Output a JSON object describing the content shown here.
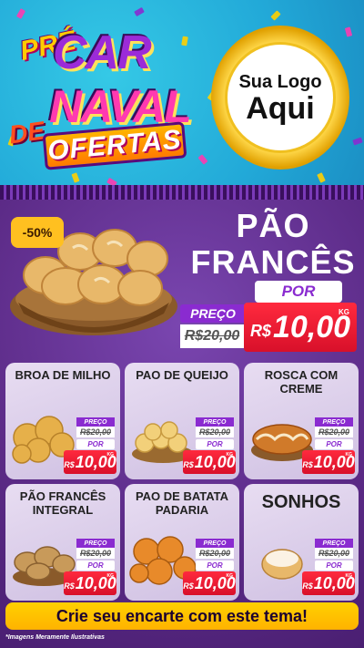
{
  "header": {
    "pre": "PRÉ",
    "car": "CAR",
    "naval": "NAVAL",
    "de": "DE",
    "ofertas": "OFERTAS",
    "logo_line1": "Sua Logo",
    "logo_line2": "Aqui"
  },
  "hero": {
    "discount_badge": "-50%",
    "title_line1": "PÃO",
    "title_line2": "FRANCÊS",
    "preco_label": "PREÇO",
    "old_price": "R$20,00",
    "por_label": "POR",
    "currency": "R$",
    "price": "10,00",
    "unit": "KG"
  },
  "cards": [
    {
      "name": "BROA DE MILHO",
      "preco_label": "PREÇO",
      "old_price": "R$20,00",
      "por_label": "POR",
      "currency": "R$",
      "price": "10,00",
      "unit": "KG"
    },
    {
      "name": "PAO DE QUEIJO",
      "preco_label": "PREÇO",
      "old_price": "R$20,00",
      "por_label": "POR",
      "currency": "R$",
      "price": "10,00",
      "unit": "KG"
    },
    {
      "name": "ROSCA COM CREME",
      "preco_label": "PREÇO",
      "old_price": "R$20,00",
      "por_label": "POR",
      "currency": "R$",
      "price": "10,00",
      "unit": "KG"
    },
    {
      "name": "PÃO FRANCÊS INTEGRAL",
      "preco_label": "PREÇO",
      "old_price": "R$20,00",
      "por_label": "POR",
      "currency": "R$",
      "price": "10,00",
      "unit": "KG"
    },
    {
      "name": "PAO DE BATATA PADARIA",
      "preco_label": "PREÇO",
      "old_price": "R$20,00",
      "por_label": "POR",
      "currency": "R$",
      "price": "10,00",
      "unit": "KG"
    },
    {
      "name": "SONHOS",
      "preco_label": "PREÇO",
      "old_price": "R$20,00",
      "por_label": "POR",
      "currency": "R$",
      "price": "10,00",
      "unit": "KG"
    }
  ],
  "footer": {
    "cta": "Crie seu encarte com este tema!",
    "note": "*Imagens Meramente Ilustrativas"
  },
  "colors": {
    "sky": "#22a9d8",
    "purple": "#5b2a86",
    "accent_purple": "#8a2bd0",
    "price_red": "#e0142e",
    "yellow": "#ffc020"
  }
}
